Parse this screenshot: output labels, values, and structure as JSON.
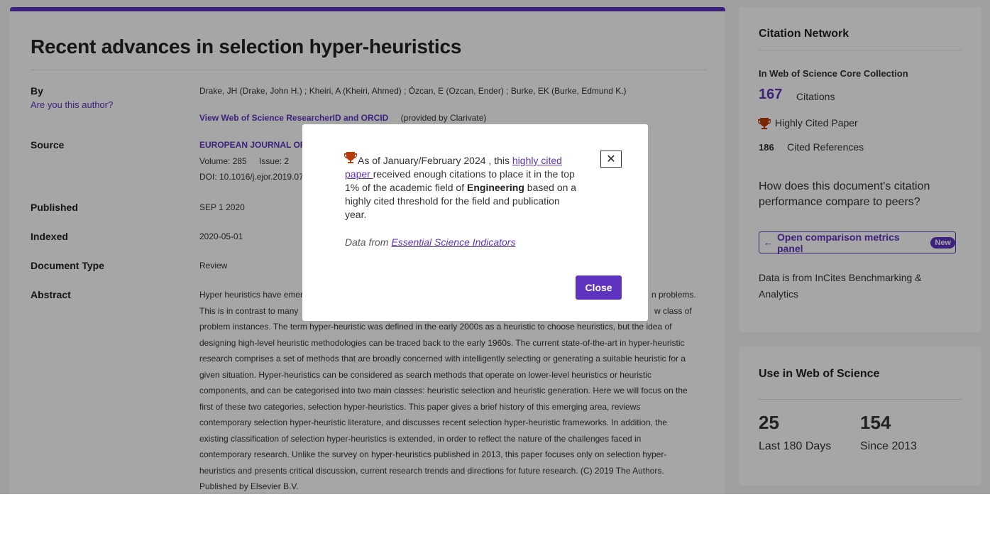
{
  "record": {
    "title": "Recent advances in selection hyper-heuristics",
    "by_label": "By",
    "authors": "Drake, JH (Drake, John H.) ; Kheiri, A (Kheiri, Ahmed) ; Özcan, E (Ozcan, Ender) ; Burke, EK (Burke, Edmund K.)",
    "author_question": "Are you this author?",
    "researcher_link": "View Web of Science ResearcherID and ORCID",
    "provided_by": "(provided by Clarivate)",
    "source_label": "Source",
    "source_journal": "EUROPEAN JOURNAL OF O",
    "volume": "Volume: 285",
    "issue": "Issue: 2",
    "doi": "DOI: 10.1016/j.ejor.2019.07",
    "published_label": "Published",
    "published": "SEP 1 2020",
    "indexed_label": "Indexed",
    "indexed": "2020-05-01",
    "doctype_label": "Document Type",
    "doctype": "Review",
    "abstract_label": "Abstract",
    "abstract_lines": [
      "Hyper heuristics have emer",
      "This is in contrast to many",
      "problem instances. The term hyper-heuristic was defined in the early 2000s as a heuristic to choose heuristics, but the idea of",
      "designing high-level heuristic methodologies can be traced back to the early 1960s. The current state-of-the-art in hyper-heuristic",
      "research comprises a set of methods that are broadly concerned with intelligently selecting or generating a suitable heuristic for a",
      "given situation. Hyper-heuristics can be considered as search methods that operate on lower-level heuristics or heuristic",
      "components, and can be categorised into two main classes: heuristic selection and heuristic generation. Here we will focus on the",
      "first of these two categories, selection hyper-heuristics. This paper gives a brief history of this emerging area, reviews",
      "contemporary selection hyper-heuristic literature, and discusses recent selection hyper-heuristic frameworks. In addition, the",
      "existing classification of selection hyper-heuristics is extended, in order to reflect the nature of the challenges faced in",
      "contemporary research. Unlike the survey on hyper-heuristics published in 2013, this paper focuses only on selection hyper-",
      "heuristics and presents critical discussion, current research trends and directions for future research. (C) 2019 The Authors.",
      "Published by Elsevier B.V."
    ],
    "abstract_right_1": "n problems.",
    "abstract_right_2": "w class of"
  },
  "citation_network": {
    "title": "Citation Network",
    "collection_label": "In Web of Science Core Collection",
    "citations_count": "167",
    "citations_label": "Citations",
    "highly_cited_label": "Highly Cited Paper",
    "cited_refs_count": "186",
    "cited_refs_label": "Cited References",
    "question": "How does this document's citation performance compare to peers?",
    "compare_button": "Open comparison metrics panel",
    "new_badge": "New",
    "incites_note": "Data is from InCites Benchmarking & Analytics"
  },
  "usage": {
    "title": "Use in Web of Science",
    "last180_value": "25",
    "last180_label": "Last 180 Days",
    "since2013_value": "154",
    "since2013_label": "Since 2013"
  },
  "modal": {
    "text_part1": "As of January/February 2024 , this ",
    "link_text": "highly cited paper ",
    "text_part2": "received enough citations to place it in the top 1% of the academic field of ",
    "field_name": "Engineering",
    "text_part3": " based on a highly cited threshold for the field and publication year.",
    "data_from": "Data from ",
    "data_source_link": "Essential Science Indicators",
    "x_label": "✕",
    "close_label": "Close"
  },
  "icons": {
    "trophy": "trophy-icon",
    "back_arrow": "arrow-left-icon",
    "close": "close-icon"
  },
  "colors": {
    "accent": "#5e33bf",
    "trophy": "#b83b0a"
  }
}
